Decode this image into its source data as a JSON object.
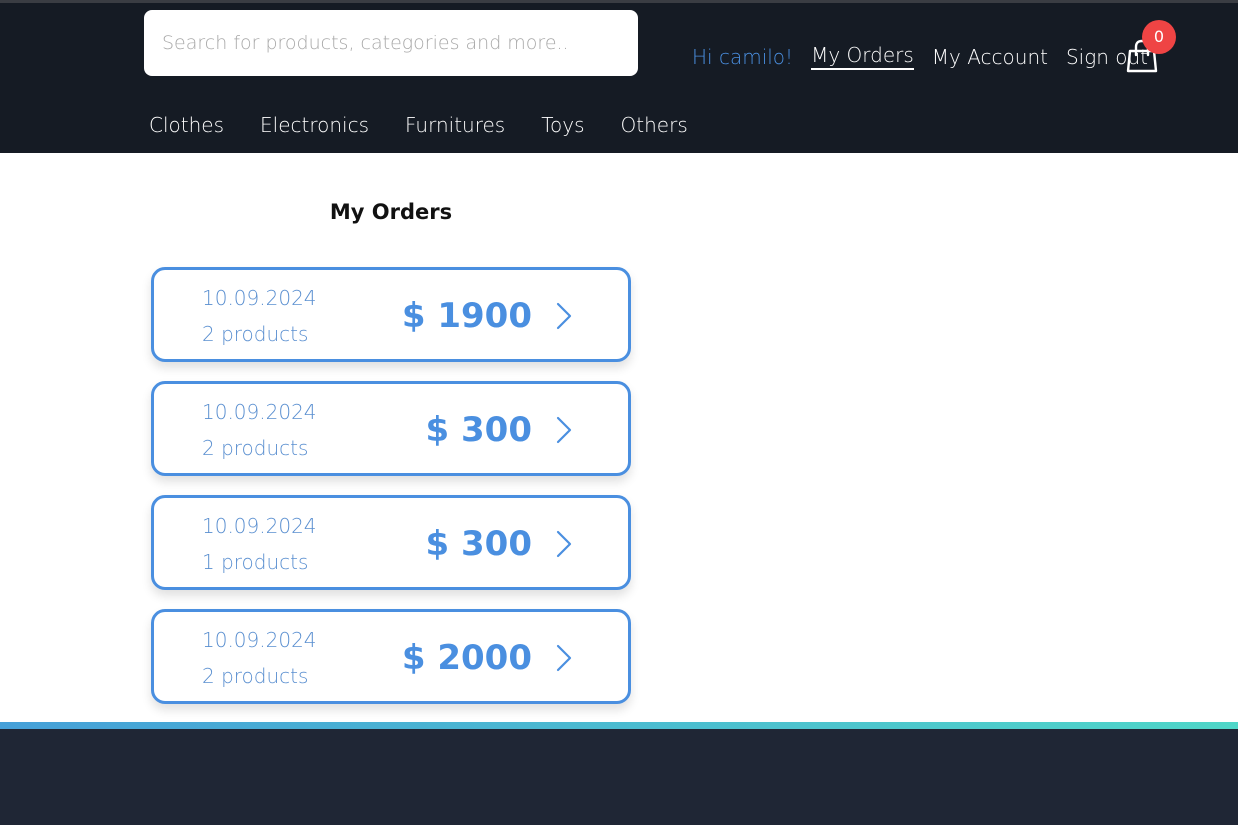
{
  "header": {
    "search_placeholder": "Search for products, categories and more..",
    "greeting": "Hi camilo!",
    "nav": {
      "my_orders": "My Orders",
      "my_account": "My Account",
      "sign_out": "Sign out"
    },
    "cart_count": "0",
    "icons": {
      "cart": "shopping-bag-icon"
    },
    "categories": [
      "Clothes",
      "Electronics",
      "Furnitures",
      "Toys",
      "Others"
    ]
  },
  "main": {
    "title": "My Orders",
    "orders": [
      {
        "date": "10.09.2024",
        "products": "2 products",
        "total": "$ 1900"
      },
      {
        "date": "10.09.2024",
        "products": "2 products",
        "total": "$ 300"
      },
      {
        "date": "10.09.2024",
        "products": "1 products",
        "total": "$ 300"
      },
      {
        "date": "10.09.2024",
        "products": "2 products",
        "total": "$ 2000"
      }
    ]
  },
  "colors": {
    "header_bg": "#151b24",
    "accent": "#4a8fe0",
    "badge": "#ef4444",
    "footer_bg": "#1f2635"
  }
}
